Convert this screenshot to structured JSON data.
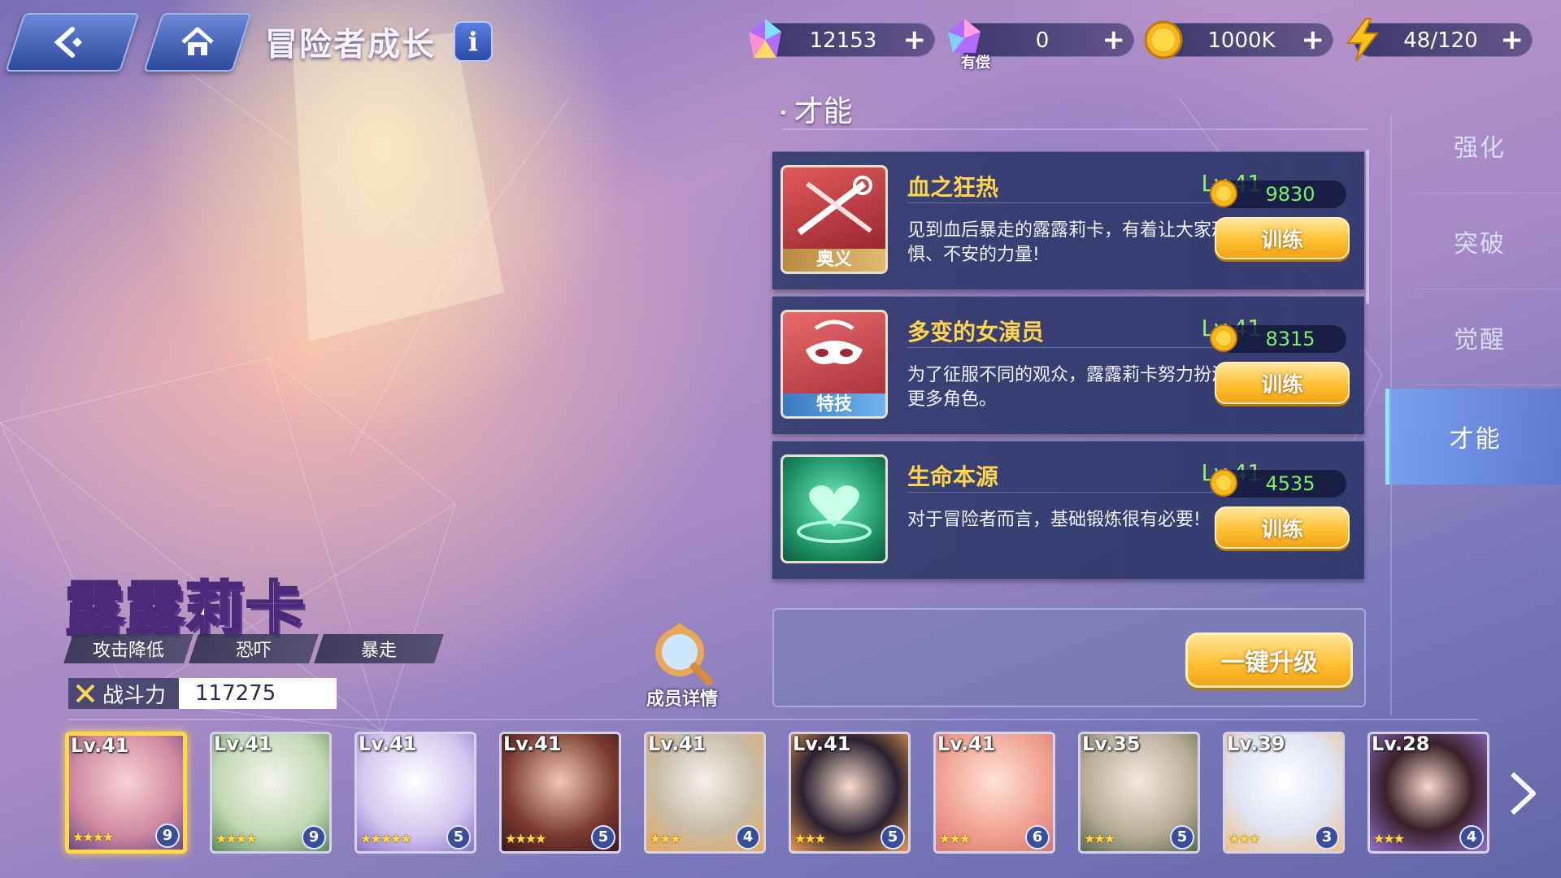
{
  "header": {
    "title": "冒险者成长",
    "info_label": "i"
  },
  "currencies": [
    {
      "icon": "gem-icon",
      "value": "12153",
      "sub": ""
    },
    {
      "icon": "paid-gem-icon",
      "value": "0",
      "sub": "有偿"
    },
    {
      "icon": "gold-coin-icon",
      "value": "1000K",
      "sub": ""
    },
    {
      "icon": "stamina-bolt-icon",
      "value": "48/120",
      "sub": ""
    }
  ],
  "side_tabs": [
    "强化",
    "突破",
    "觉醒",
    "才能"
  ],
  "active_tab": "才能",
  "talents": {
    "section_title": "才能",
    "items": [
      {
        "name": "血之狂热",
        "level": "Lv.41",
        "badge": "奥义",
        "desc": "见到血后暴走的露露莉卡，有着让大家恐惧、不安的力量!",
        "cost": "9830",
        "button": "训练",
        "badge_color": "#c9a25a"
      },
      {
        "name": "多变的女演员",
        "level": "Lv.41",
        "badge": "特技",
        "desc": "为了征服不同的观众，露露莉卡努力扮演着更多角色。",
        "cost": "8315",
        "button": "训练",
        "badge_color": "#4a8fd0"
      },
      {
        "name": "生命本源",
        "level": "Lv.41",
        "badge": "",
        "desc": "对于冒险者而言，基础锻炼很有必要!",
        "cost": "4535",
        "button": "训练",
        "badge_color": ""
      }
    ],
    "upgrade_all": "一键升级"
  },
  "character": {
    "name": "露露莉卡",
    "tags": [
      "攻击降低",
      "恐吓",
      "暴走"
    ],
    "power_label": "战斗力",
    "power_value": "117275",
    "member_detail": "成员详情"
  },
  "roster": [
    {
      "level": "Lv.41",
      "stars": "★★★★",
      "rank": "9",
      "selected": true,
      "bg": "#e7a9b6"
    },
    {
      "level": "Lv.41",
      "stars": "★★★★",
      "rank": "9",
      "selected": false,
      "bg": "#cfe3c4"
    },
    {
      "level": "Lv.41",
      "stars": "★★★★★",
      "rank": "5",
      "selected": false,
      "bg": "#c7b8ea"
    },
    {
      "level": "Lv.41",
      "stars": "★★★★",
      "rank": "5",
      "selected": false,
      "bg": "#8a4b3e"
    },
    {
      "level": "Lv.41",
      "stars": "★★★",
      "rank": "4",
      "selected": false,
      "bg": "#f2c48a"
    },
    {
      "level": "Lv.41",
      "stars": "★★★",
      "rank": "5",
      "selected": false,
      "bg": "#e8b070"
    },
    {
      "level": "Lv.41",
      "stars": "★★★",
      "rank": "6",
      "selected": false,
      "bg": "#f0a89a"
    },
    {
      "level": "Lv.35",
      "stars": "★★★",
      "rank": "5",
      "selected": false,
      "bg": "#c0b8a8"
    },
    {
      "level": "Lv.39",
      "stars": "★★★",
      "rank": "3",
      "selected": false,
      "bg": "#f4c890"
    },
    {
      "level": "Lv.28",
      "stars": "★★★",
      "rank": "4",
      "selected": false,
      "bg": "#a890d8"
    }
  ]
}
